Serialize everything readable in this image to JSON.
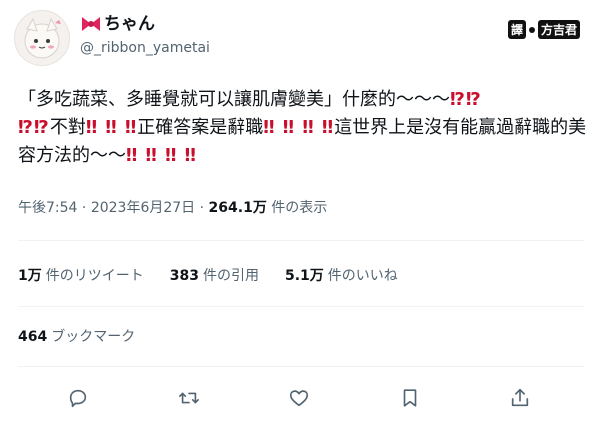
{
  "author": {
    "display_name": "ちゃん",
    "handle": "@_ribbon_yametai",
    "emoji_icon": "ribbon-icon",
    "avatar_icon": "avatar-character"
  },
  "watermark": {
    "prefix": "譯",
    "brand": "方吉君"
  },
  "tweet": {
    "segments": [
      {
        "text": "「多吃蔬菜、多睡覺就可以讓肌膚變美」什麼的〜〜〜",
        "emphasis": false
      },
      {
        "text": "⁉⁉",
        "emphasis": true
      },
      {
        "text": "⁉⁉",
        "emphasis": true
      },
      {
        "text": "不對",
        "emphasis": false
      },
      {
        "text": "‼ ‼ ‼",
        "emphasis": true
      },
      {
        "text": "正確答案是辭職",
        "emphasis": false
      },
      {
        "text": "‼ ‼ ‼ ‼",
        "emphasis": true
      },
      {
        "text": "這世界上是沒有能贏過辭職的美容方法的〜〜",
        "emphasis": false
      },
      {
        "text": "‼ ‼ ‼ ‼",
        "emphasis": true
      }
    ]
  },
  "meta": {
    "time": "午後7:54",
    "separator": "·",
    "date": "2023年6月27日",
    "views_count": "264.1万",
    "views_label": "件の表示"
  },
  "stats": {
    "retweets_count": "1万",
    "retweets_label": "件のリツイート",
    "quotes_count": "383",
    "quotes_label": "件の引用",
    "likes_count": "5.1万",
    "likes_label": "件のいいね"
  },
  "bookmarks": {
    "count": "464",
    "label": "ブックマーク"
  },
  "colors": {
    "text": "#0f1419",
    "secondary": "#536471",
    "emphasis": "#c8102e",
    "divider": "#eff3f4"
  }
}
